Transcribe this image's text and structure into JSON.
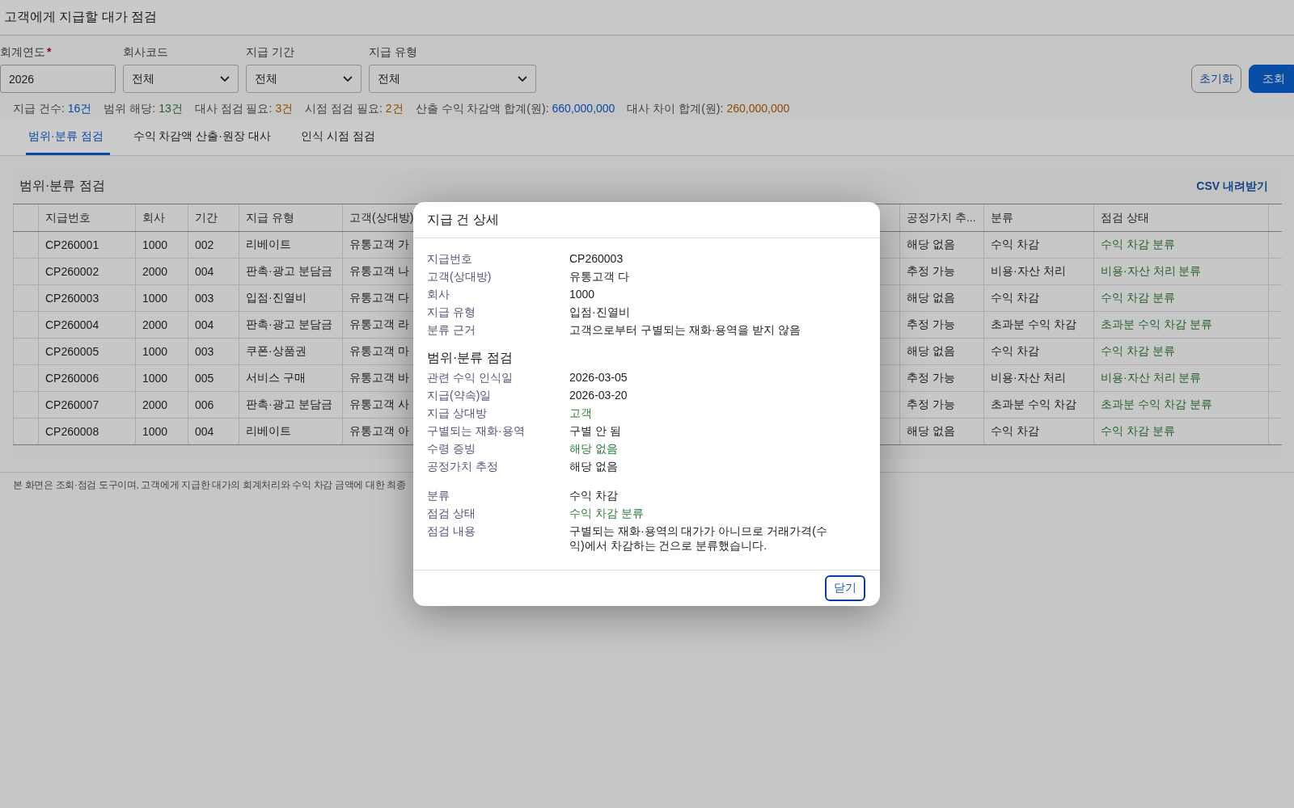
{
  "page_title": "고객에게 지급할 대가 점검",
  "filters": [
    {
      "kind": "text",
      "label": "회계연도",
      "required_mark": "*",
      "value": "2026"
    },
    {
      "kind": "select",
      "label": "회사코드",
      "value": "전체"
    },
    {
      "kind": "select",
      "label": "지급 기간",
      "value": "전체"
    },
    {
      "kind": "select",
      "label": "지급 유형",
      "value": "전체"
    }
  ],
  "buttons": [
    {
      "kind": "secondary",
      "label": "초기화"
    },
    {
      "kind": "primary",
      "label": "조회"
    }
  ],
  "summary": [
    {
      "label": "지급 건수:",
      "value": "16건",
      "color": "#0a4aa2"
    },
    {
      "label": "범위 해당:",
      "value": "13건",
      "color": "#235f2d"
    },
    {
      "label": "대사 점검 필요:",
      "value": "3건",
      "color": "#8d4b05"
    },
    {
      "label": "시점 점검 필요:",
      "value": "2건",
      "color": "#8d4b05"
    },
    {
      "label": "산출 수익 차감액 합계(원):",
      "value": "660,000,000",
      "color": "#0a4aa2"
    },
    {
      "label": "대사 차이 합계(원):",
      "value": "260,000,000",
      "color": "#8d4b05"
    }
  ],
  "tabs": [
    {
      "label": "범위·분류 점검",
      "selected": true
    },
    {
      "label": "수익 차감액 산출·원장 대사",
      "selected": false
    },
    {
      "label": "인식 시점 점검",
      "selected": false
    }
  ],
  "panel": {
    "title": "범위·분류 점검",
    "action": "CSV 내려받기",
    "table": {
      "columns": [
        "지급번호",
        "회사",
        "기간",
        "지급 유형",
        "고객(상대방)",
        "공정가치 추...",
        "분류",
        "점검 상태"
      ],
      "rows": [
        [
          "CP260001",
          "1000",
          "002",
          "리베이트",
          "유통고객 가",
          "해당 없음",
          "수익 차감",
          "수익 차감 분류"
        ],
        [
          "CP260002",
          "2000",
          "004",
          "판촉·광고 분담금",
          "유통고객 나",
          "추정 가능",
          "비용·자산 처리",
          "비용·자산 처리 분류"
        ],
        [
          "CP260003",
          "1000",
          "003",
          "입점·진열비",
          "유통고객 다",
          "해당 없음",
          "수익 차감",
          "수익 차감 분류"
        ],
        [
          "CP260004",
          "2000",
          "004",
          "판촉·광고 분담금",
          "유통고객 라",
          "추정 가능",
          "초과분 수익 차감",
          "초과분 수익 차감 분류"
        ],
        [
          "CP260005",
          "1000",
          "003",
          "쿠폰·상품권",
          "유통고객 마",
          "해당 없음",
          "수익 차감",
          "수익 차감 분류"
        ],
        [
          "CP260006",
          "1000",
          "005",
          "서비스 구매",
          "유통고객 바",
          "추정 가능",
          "비용·자산 처리",
          "비용·자산 처리 분류"
        ],
        [
          "CP260007",
          "2000",
          "006",
          "판촉·광고 분담금",
          "유통고객 사",
          "추정 가능",
          "초과분 수익 차감",
          "초과분 수익 차감 분류"
        ],
        [
          "CP260008",
          "1000",
          "004",
          "리베이트",
          "유통고객 아",
          "해당 없음",
          "수익 차감",
          "수익 차감 분류"
        ]
      ]
    }
  },
  "footer_note": "본 화면은 조회·점검 도구이며, 고객에게 지급한 대가의 회계처리와 수익 차감 금액에 대한 최종",
  "modal": {
    "title": "지급 건 상세",
    "sections": [
      {
        "fields": [
          {
            "label": "지급번호",
            "value": "CP260003",
            "color": "#222222"
          },
          {
            "label": "고객(상대방)",
            "value": "유통고객 다",
            "color": "#222222"
          },
          {
            "label": "회사",
            "value": "1000",
            "color": "#222222"
          },
          {
            "label": "지급 유형",
            "value": "입점·진열비",
            "color": "#222222"
          },
          {
            "label": "분류 근거",
            "value": "고객으로부터 구별되는 재화·용역을 받지 않음",
            "color": "#222222"
          }
        ]
      },
      {
        "heading": "범위·분류 점검",
        "fields": [
          {
            "label": "관련 수익 인식일",
            "value": "2026-03-05",
            "color": "#222222"
          },
          {
            "label": "지급(약속)일",
            "value": "2026-03-20",
            "color": "#222222"
          },
          {
            "label": "지급 상대방",
            "value": "고객",
            "color": "#2d7a3a"
          },
          {
            "label": "구별되는 재화·용역",
            "value": "구별 안 됨",
            "color": "#222222"
          },
          {
            "label": "수령 증빙",
            "value": "해당 없음",
            "color": "#2d7a3a"
          },
          {
            "label": "공정가치 추정",
            "value": "해당 없음",
            "color": "#222222"
          }
        ]
      },
      {
        "fields": [
          {
            "label": "분류",
            "value": "수익 차감",
            "color": "#222222"
          },
          {
            "label": "점검 상태",
            "value": "수익 차감 분류",
            "color": "#2d7a3a"
          },
          {
            "label": "점검 내용",
            "value": "구별되는 재화·용역의 대가가 아니므로 거래가격(수익)에서 차감하는 건으로 분류했습니다.",
            "color": "#222222"
          }
        ]
      }
    ],
    "close_label": "닫기"
  }
}
